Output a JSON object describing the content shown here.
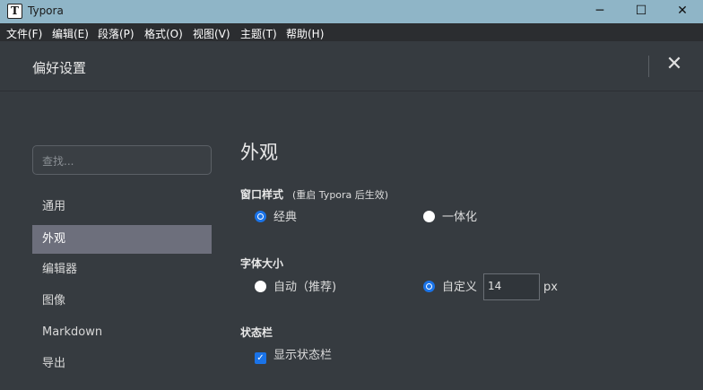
{
  "window": {
    "icon_letter": "T",
    "title": "Typora",
    "minimize": "─",
    "maximize": "☐",
    "close": "✕"
  },
  "menu": [
    "文件(F)",
    "编辑(E)",
    "段落(P)",
    "格式(O)",
    "视图(V)",
    "主题(T)",
    "帮助(H)"
  ],
  "dialog": {
    "title": "偏好设置",
    "close_glyph": "✕"
  },
  "sidebar": {
    "search_placeholder": "查找...",
    "items": [
      {
        "label": "通用",
        "active": false
      },
      {
        "label": "外观",
        "active": true
      },
      {
        "label": "编辑器",
        "active": false
      },
      {
        "label": "图像",
        "active": false
      },
      {
        "label": "Markdown",
        "active": false
      },
      {
        "label": "导出",
        "active": false
      }
    ]
  },
  "main": {
    "title": "外观",
    "window_style": {
      "label": "窗口样式",
      "note": "(重启 Typora 后生效)",
      "options": [
        {
          "label": "经典",
          "selected": true
        },
        {
          "label": "一体化",
          "selected": false
        }
      ]
    },
    "font_size": {
      "label": "字体大小",
      "options": [
        {
          "label": "自动（推荐)",
          "selected": false
        },
        {
          "label": "自定义",
          "selected": true
        }
      ],
      "value": "14",
      "unit": "px"
    },
    "status_bar": {
      "label": "状态栏",
      "checkbox_label": "显示状态栏",
      "checked": true
    }
  },
  "colors": {
    "titlebar": "#8fb5c7",
    "background": "#363b40",
    "active_item": "#6d6f7c",
    "accent": "#1a73e8"
  }
}
